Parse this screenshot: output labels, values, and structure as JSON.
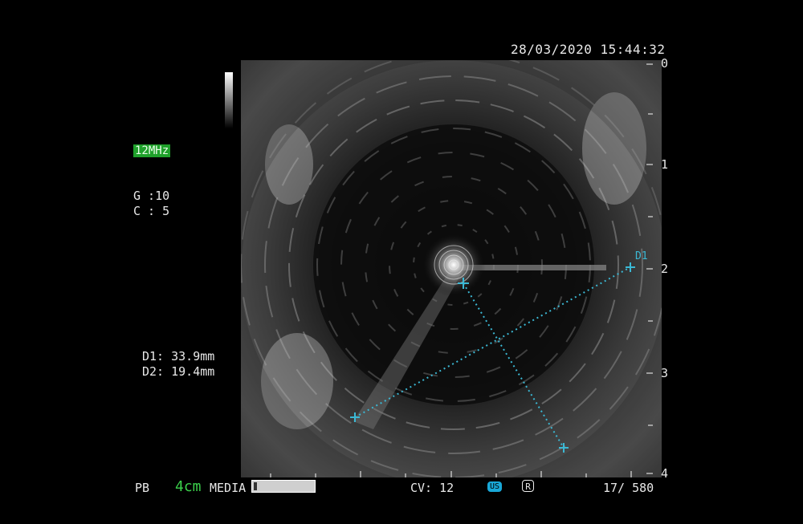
{
  "header": {
    "datetime": "28/03/2020 15:44:32"
  },
  "left_panel": {
    "frequency": "12MHz",
    "gain": "G :10",
    "contrast": "C : 5",
    "measurement_d1": "D1: 33.9mm",
    "measurement_d2": "D2: 19.4mm"
  },
  "viewer": {
    "measurement_label": "D1",
    "caliper_color": "#3bb8d4",
    "depth_scale_labels": [
      "0",
      "1",
      "2",
      "3",
      "4"
    ]
  },
  "bottom_bar": {
    "mode": "PB",
    "depth": "4cm",
    "media_label": "MEDIA",
    "cv": "CV: 12",
    "us_badge": "US",
    "record_icon_label": "R",
    "frame_counter": "17/  580"
  },
  "colors": {
    "frequency_badge_bg": "#1fa12b",
    "depth_text": "#3bd04b",
    "us_badge_bg": "#19a8d8"
  }
}
